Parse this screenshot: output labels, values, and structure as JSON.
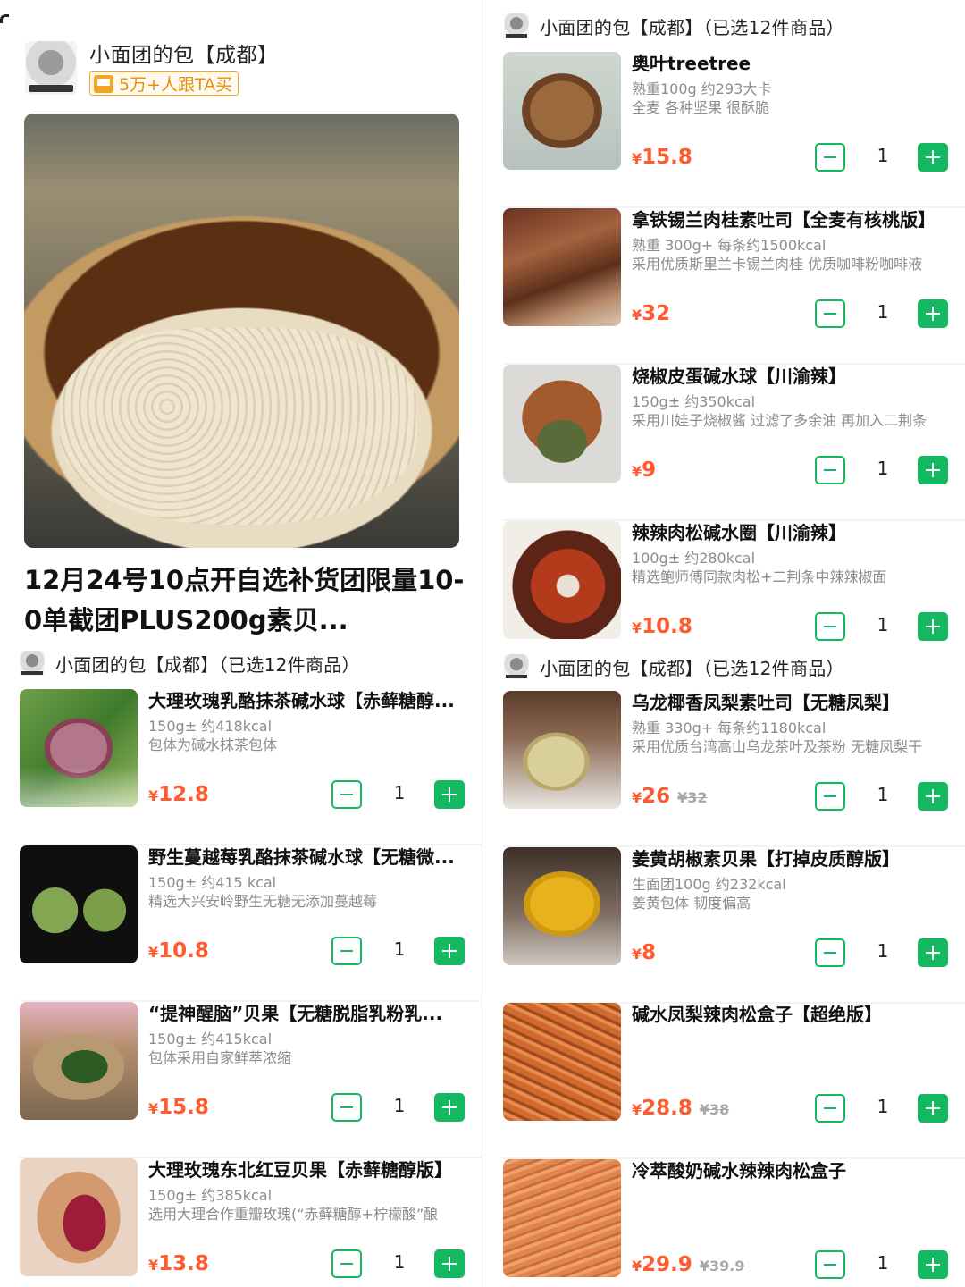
{
  "left": {
    "shop_name": "小面团的包【成都】",
    "buy_badge": "5万+人跟TA买",
    "post_title_line1": "12月24号10点开自选补货团限量10-",
    "post_title_line2": "0单截团PLUS200g素贝...",
    "group_header": "小面团的包【成都】（已选12件商品）",
    "products": [
      {
        "name": "大理玫瑰乳酪抹茶碱水球【赤藓糖醇...",
        "spec": "150g± 约418kcal",
        "desc": "包体为碱水抹茶包体",
        "price": "12.8",
        "orig": "",
        "qty": "1"
      },
      {
        "name": "野生蔓越莓乳酪抹茶碱水球【无糖微...",
        "spec": "150g± 约415 kcal",
        "desc": "精选大兴安岭野生无糖无添加蔓越莓",
        "price": "10.8",
        "orig": "",
        "qty": "1"
      },
      {
        "name": "“提神醒脑”贝果【无糖脱脂乳粉乳...",
        "spec": "150g± 约415kcal",
        "desc": "包体采用自家鲜萃浓缩",
        "price": "15.8",
        "orig": "",
        "qty": "1"
      },
      {
        "name": "大理玫瑰东北红豆贝果【赤藓糖醇版】",
        "spec": "150g± 约385kcal",
        "desc": "选用大理合作重瓣玫瑰(“赤藓糖醇+柠檬酸”酿",
        "price": "13.8",
        "orig": "",
        "qty": "1"
      }
    ]
  },
  "right": {
    "group_header_1": "小面团的包【成都】（已选12件商品）",
    "group_header_2": "小面团的包【成都】（已选12件商品）",
    "products_top": [
      {
        "name": "奥叶treetree",
        "spec": "熟重100g 约293大卡",
        "desc": "全麦 各种坚果 很酥脆",
        "price": "15.8",
        "orig": "",
        "qty": "1"
      },
      {
        "name": "拿铁锡兰肉桂素吐司【全麦有核桃版】",
        "spec": "熟重 300g+ 每条约1500kcal",
        "desc": "采用优质斯里兰卡锡兰肉桂 优质咖啡粉咖啡液",
        "price": "32",
        "orig": "",
        "qty": "1"
      },
      {
        "name": "烧椒皮蛋碱水球【川渝辣】",
        "spec": "150g± 约350kcal",
        "desc": "采用川娃子烧椒酱 过滤了多余油 再加入二荆条",
        "price": "9",
        "orig": "",
        "qty": "1"
      },
      {
        "name": "辣辣肉松碱水圈【川渝辣】",
        "spec": "100g± 约280kcal",
        "desc": "精选鲍师傅同款肉松+二荆条中辣辣椒面",
        "price": "10.8",
        "orig": "",
        "qty": "1"
      }
    ],
    "products_bottom": [
      {
        "name": "乌龙椰香凤梨素吐司【无糖凤梨】",
        "spec": "熟重 330g+ 每条约1180kcal",
        "desc": "采用优质台湾高山乌龙茶叶及茶粉 无糖凤梨干",
        "price": "26",
        "orig": "¥32",
        "qty": "1"
      },
      {
        "name": "姜黄胡椒素贝果【打掉皮质醇版】",
        "spec": "生面团100g 约232kcal",
        "desc": "姜黄包体 韧度偏高",
        "price": "8",
        "orig": "",
        "qty": "1"
      },
      {
        "name": "碱水凤梨辣肉松盒子【超绝版】",
        "spec": "",
        "desc": "",
        "price": "28.8",
        "orig": "¥38",
        "qty": "1"
      },
      {
        "name": "冷萃酸奶碱水辣辣肉松盒子",
        "spec": "",
        "desc": "",
        "price": "29.9",
        "orig": "¥39.9",
        "qty": "1"
      }
    ]
  },
  "currency": "¥",
  "colors": {
    "accent_green": "#13b861",
    "price_orange": "#ff5b2e",
    "badge_orange": "#f4a623"
  },
  "icons": [
    "shop-avatar",
    "cart-icon",
    "minus-icon",
    "plus-icon"
  ]
}
